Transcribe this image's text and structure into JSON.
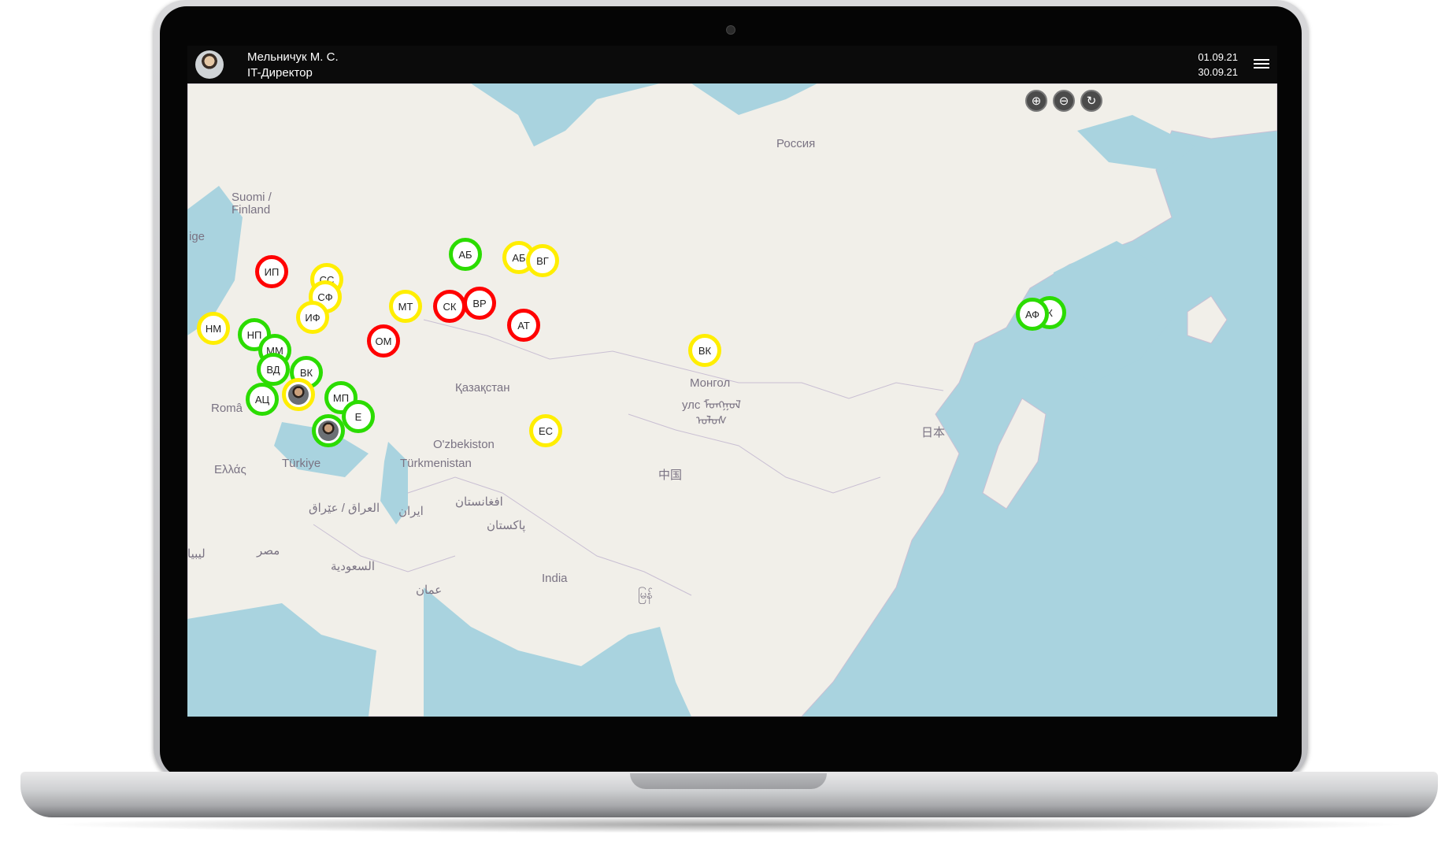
{
  "header": {
    "user_name": "Мельничук М. С.",
    "user_role": "IT-Директор",
    "date_from": "01.09.21",
    "date_to": "30.09.21"
  },
  "icons": {
    "menu": "hamburger-icon",
    "zoom_in": "zoom-in-icon",
    "zoom_out": "zoom-out-icon",
    "refresh": "refresh-icon"
  },
  "colors": {
    "red": "#ff0000",
    "yellow": "#ffee00",
    "green": "#2bdc00"
  },
  "controls": {
    "zoom_in": "⊕",
    "zoom_out": "⊖",
    "refresh": "↻"
  },
  "map_labels": [
    "Россия",
    "Suomi /",
    "Finland",
    "ige",
    "Қазақстан",
    "Монгол",
    "улс ᠮᠣᠩᠭᠣᠯ",
    "ᠤᠯᠤᠰ",
    "O'zbekiston",
    "Türkmenistan",
    "Türkiye",
    "Ελλάς",
    "Româ",
    "日本",
    "中国",
    "العراق / عێراق",
    "ایران",
    "افغانستان",
    "پاکستان",
    "مصر",
    "السعودية",
    "عمان",
    "India",
    "ليبيا",
    "မြန်"
  ],
  "markers": [
    {
      "label": "ИП",
      "status": "red"
    },
    {
      "label": "СС",
      "status": "yellow"
    },
    {
      "label": "СФ",
      "status": "yellow"
    },
    {
      "label": "ИФ",
      "status": "yellow"
    },
    {
      "label": "НМ",
      "status": "yellow"
    },
    {
      "label": "НП",
      "status": "green"
    },
    {
      "label": "ММ",
      "status": "green"
    },
    {
      "label": "ВД",
      "status": "green"
    },
    {
      "label": "ВК",
      "status": "green"
    },
    {
      "label": "АЦ",
      "status": "green"
    },
    {
      "label": "",
      "status": "yellow"
    },
    {
      "label": "МП",
      "status": "green"
    },
    {
      "label": "Е",
      "status": "green"
    },
    {
      "label": "",
      "status": "green"
    },
    {
      "label": "АБ",
      "status": "green"
    },
    {
      "label": "АБ",
      "status": "yellow"
    },
    {
      "label": "ВГ",
      "status": "yellow"
    },
    {
      "label": "МТ",
      "status": "yellow"
    },
    {
      "label": "СК",
      "status": "red"
    },
    {
      "label": "ВР",
      "status": "red"
    },
    {
      "label": "АТ",
      "status": "red"
    },
    {
      "label": "ОМ",
      "status": "red"
    },
    {
      "label": "ВК",
      "status": "yellow"
    },
    {
      "label": "ЕС",
      "status": "yellow"
    },
    {
      "label": "К",
      "status": "green"
    },
    {
      "label": "АФ",
      "status": "green"
    }
  ]
}
